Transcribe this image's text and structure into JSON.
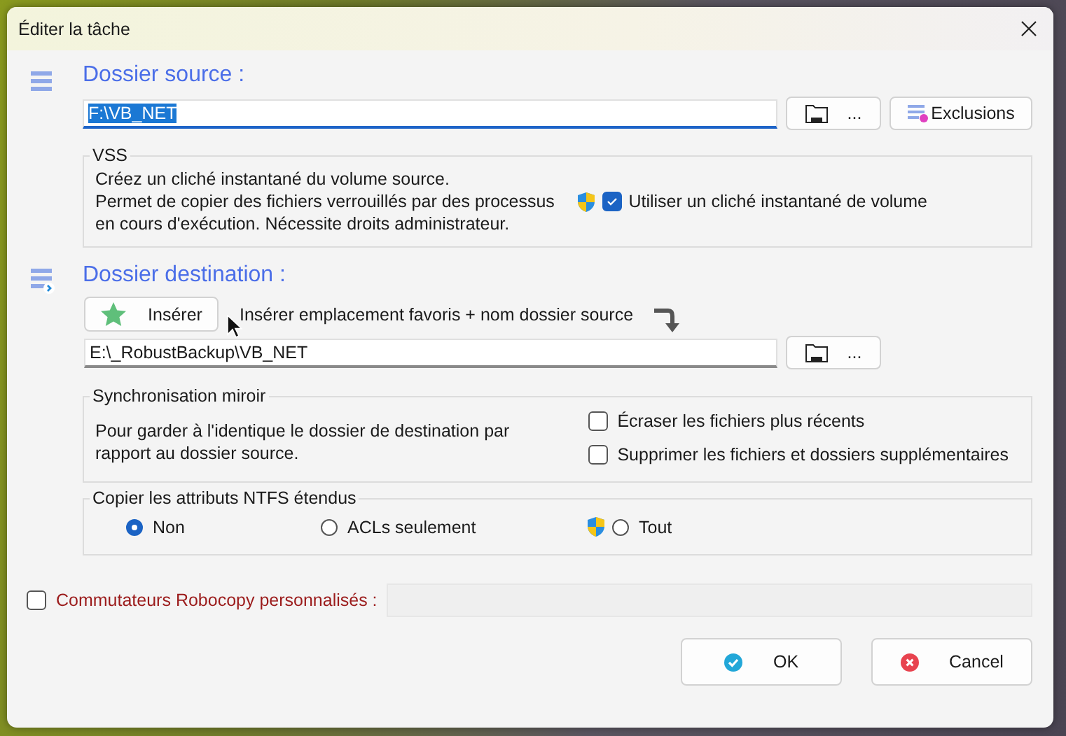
{
  "window": {
    "title": "Éditer la tâche"
  },
  "source": {
    "heading": "Dossier source :",
    "path": "F:\\VB_NET",
    "path_selected": true,
    "browse_label": "...",
    "exclusions_label": "Exclusions"
  },
  "vss": {
    "legend": "VSS",
    "description": "Créez un cliché instantané du volume source.\nPermet de copier des fichiers verrouillés par des processus\nen cours d'exécution. Nécessite droits administrateur.",
    "option": {
      "label": "Utiliser un cliché instantané de volume",
      "checked": true,
      "admin": true
    }
  },
  "destination": {
    "heading": "Dossier destination :",
    "insert_button": "Insérer",
    "insert_hint": "Insérer emplacement favoris + nom dossier source",
    "path": "E:\\_RobustBackup\\VB_NET",
    "browse_label": "..."
  },
  "mirror": {
    "legend": "Synchronisation miroir",
    "description": "Pour garder à l'identique le dossier de destination par\nrapport au dossier source.",
    "options": [
      {
        "label": "Écraser les fichiers plus récents",
        "checked": false
      },
      {
        "label": "Supprimer les fichiers et dossiers supplémentaires",
        "checked": false
      }
    ]
  },
  "ntfs": {
    "legend": "Copier les attributs NTFS étendus",
    "options": [
      {
        "label": "Non",
        "selected": true,
        "admin": false
      },
      {
        "label": "ACLs seulement",
        "selected": false,
        "admin": false
      },
      {
        "label": "Tout",
        "selected": false,
        "admin": true
      }
    ]
  },
  "custom_switches": {
    "label": "Commutateurs Robocopy personnalisés :",
    "checked": false
  },
  "buttons": [
    {
      "label": "OK",
      "kind": "ok"
    },
    {
      "label": "Cancel",
      "kind": "cancel"
    }
  ]
}
